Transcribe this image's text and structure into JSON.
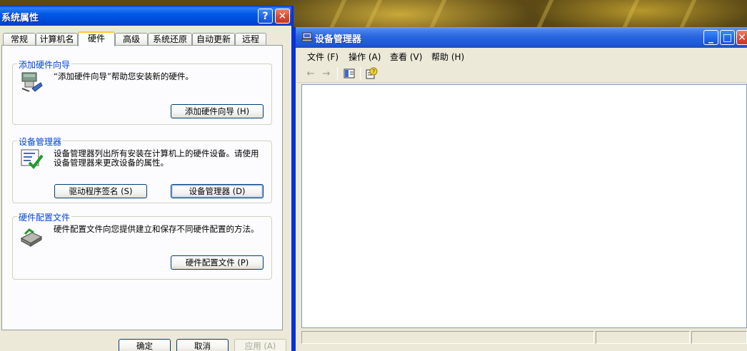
{
  "sysprop": {
    "title": "系统属性",
    "help_button": "?",
    "close_button": "✕",
    "tabs": [
      {
        "label": "常规"
      },
      {
        "label": "计算机名"
      },
      {
        "label": "硬件"
      },
      {
        "label": "高级"
      },
      {
        "label": "系统还原"
      },
      {
        "label": "自动更新"
      },
      {
        "label": "远程"
      }
    ],
    "active_tab": "硬件",
    "groups": {
      "add_hardware": {
        "title": "添加硬件向导",
        "text": "“添加硬件向导”帮助您安装新的硬件。",
        "button": "添加硬件向导 (H)"
      },
      "device_manager": {
        "title": "设备管理器",
        "text": "设备管理器列出所有安装在计算机上的硬件设备。请使用设备管理器来更改设备的属性。",
        "driver_signing_button": "驱动程序签名 (S)",
        "device_manager_button": "设备管理器 (D)"
      },
      "hardware_profiles": {
        "title": "硬件配置文件",
        "text": "硬件配置文件向您提供建立和保存不同硬件配置的方法。",
        "button": "硬件配置文件 (P)"
      }
    },
    "footer": {
      "ok": "确定",
      "cancel": "取消",
      "apply": "应用 (A)"
    }
  },
  "devmgr": {
    "title": "设备管理器",
    "minimize": "_",
    "maximize": "□",
    "close": "✕",
    "menu": [
      {
        "label": "文件 (F)"
      },
      {
        "label": "操作 (A)"
      },
      {
        "label": "查看 (V)"
      },
      {
        "label": "帮助 (H)"
      }
    ],
    "toolbar": {
      "back": "←",
      "forward": "→"
    }
  },
  "colors": {
    "xp_blue": "#0831d9",
    "dialog_bg": "#ece9d8",
    "group_title": "#0046d5",
    "tab_highlight": "#ffc83c"
  }
}
